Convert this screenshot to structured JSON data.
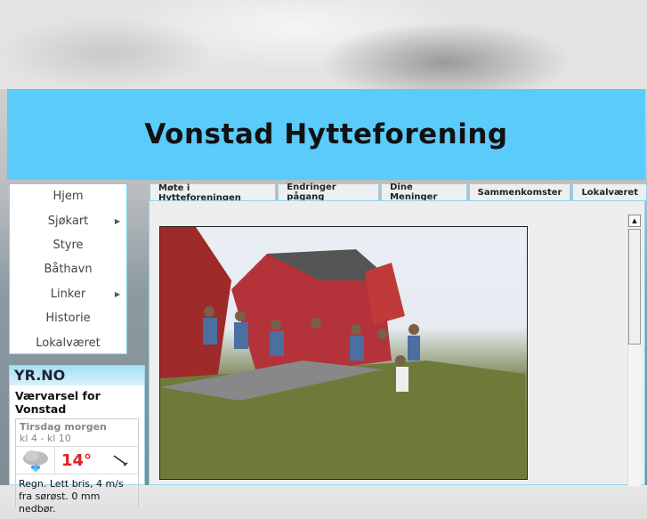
{
  "site": {
    "title": "Vonstad Hytteforening"
  },
  "menu": [
    {
      "label": "Hjem"
    },
    {
      "label": "Sjøkart",
      "submenu": true
    },
    {
      "label": "Styre"
    },
    {
      "label": "Båthavn"
    },
    {
      "label": "Linker",
      "submenu": true
    },
    {
      "label": "Historie"
    },
    {
      "label": "Lokalværet"
    }
  ],
  "tabs": [
    {
      "label": "Møte i Hytteforeningen",
      "active": true
    },
    {
      "label": "Endringer pågang"
    },
    {
      "label": "Dine Meninger"
    },
    {
      "label": "Sammenkomster"
    },
    {
      "label": "Lokalværet"
    }
  ],
  "weather": {
    "logo": "YR.NO",
    "title": "Værvarsel for Vonstad",
    "day": "Tirsdag morgen",
    "period": "kl 4 - kl 10",
    "temperature": "14°",
    "icon": "rain-cloud-icon",
    "description": "Regn. Lett bris, 4 m/s fra sørøst. 0 mm nedbør.",
    "temp_color": "#d22222"
  },
  "colors": {
    "header": "#5bcbf9",
    "accent": "#8fd5f2"
  }
}
